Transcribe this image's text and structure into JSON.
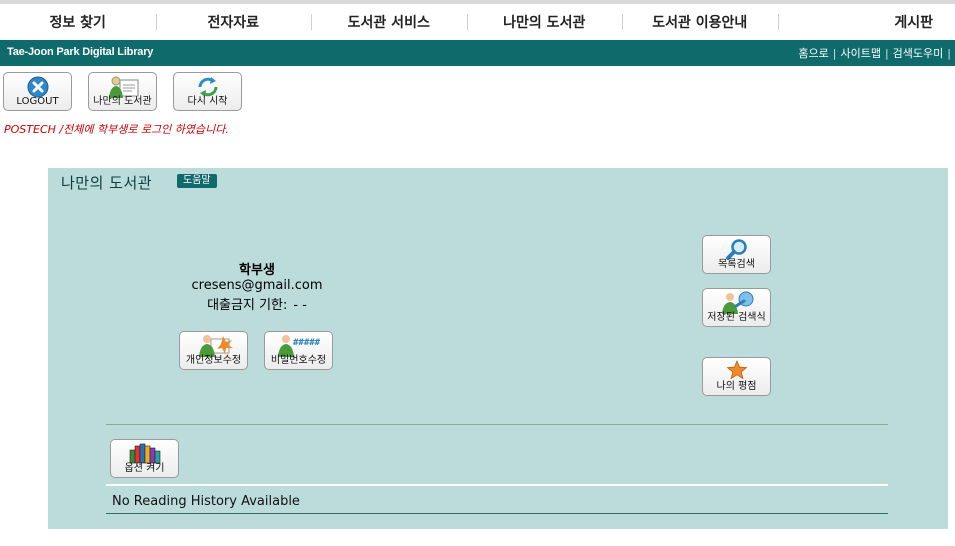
{
  "nav": {
    "items": [
      {
        "label": "정보 찾기"
      },
      {
        "label": "전자자료"
      },
      {
        "label": "도서관 서비스"
      },
      {
        "label": "나만의 도서관"
      },
      {
        "label": "도서관 이용안내"
      },
      {
        "label": "게시판"
      }
    ]
  },
  "topbar": {
    "brand": "Tae-Joon Park Digital Library",
    "links": [
      "홈으로",
      "사이트맵",
      "검색도우미"
    ]
  },
  "toolbar": {
    "logout_label": "LOGOUT",
    "mylib_label": "나만의 도서관",
    "restart_label": "다시 시작"
  },
  "login_message": "POSTECH /전체에 학부생로 로그인 하였습니다.",
  "panel": {
    "title": "나만의 도서관",
    "help_label": "도움말",
    "user": {
      "role": "학부생",
      "email": "cresens@gmail.com",
      "ban_label": "대출금지 기한:",
      "ban_value": "- -"
    },
    "buttons": {
      "edit_info": "개인정보수정",
      "change_password": "비밀번호수정",
      "password_mask": "#####",
      "catalog_search": "목록검색",
      "saved_search": "저장된 검색식",
      "my_ratings": "나의 평점",
      "options": "옵션 켜기"
    },
    "history_message": "No Reading History Available"
  },
  "colors": {
    "header_bar": "#0f6a6c",
    "panel_bg": "#bcdcdc",
    "message_red": "#cc0000"
  }
}
